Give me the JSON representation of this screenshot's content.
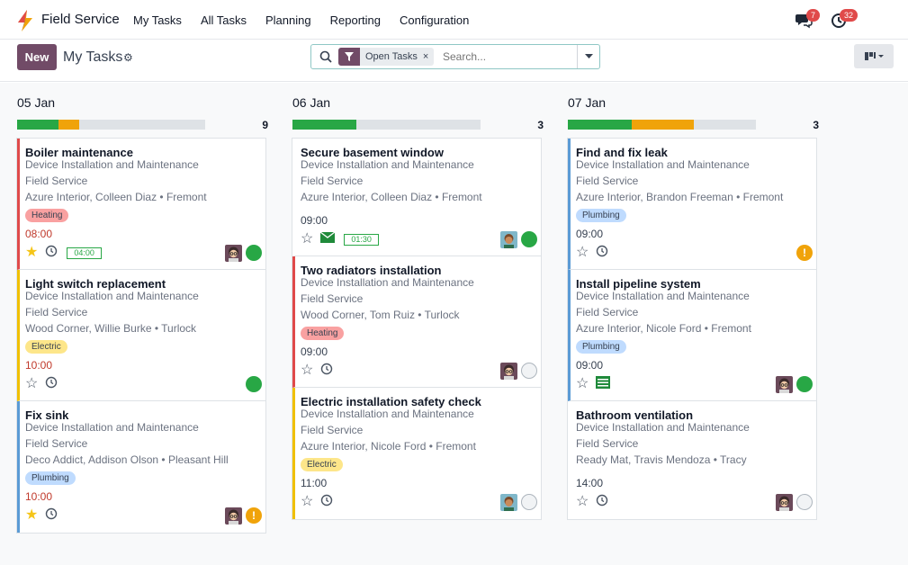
{
  "app": {
    "name": "Field Service"
  },
  "menu": [
    "My Tasks",
    "All Tasks",
    "Planning",
    "Reporting",
    "Configuration"
  ],
  "systray": {
    "messages_count": "7",
    "activities_count": "32"
  },
  "control": {
    "new_label": "New",
    "title": "My Tasks",
    "facet": "Open Tasks",
    "search_placeholder": "Search..."
  },
  "columns": [
    {
      "date": "05 Jan",
      "count": "9",
      "progress": {
        "done": 0.22,
        "warn": 0.11
      },
      "cards": [
        {
          "title": "Boiler maintenance",
          "project": "Device Installation and Maintenance",
          "team": "Field Service",
          "customer": "Azure Interior, Colleen Diaz • Fremont",
          "tag": "Heating",
          "time": "08:00",
          "overdue": true,
          "starred": true,
          "timer": "04:00",
          "status": "green",
          "avatar": "glasses"
        },
        {
          "title": "Light switch replacement",
          "project": "Device Installation and Maintenance",
          "team": "Field Service",
          "customer": "Wood Corner, Willie Burke • Turlock",
          "tag": "Electric",
          "time": "10:00",
          "overdue": true,
          "starred": false,
          "status": "green"
        },
        {
          "title": "Fix sink",
          "project": "Device Installation and Maintenance",
          "team": "Field Service",
          "customer": "Deco Addict, Addison Olson • Pleasant Hill",
          "tag": "Plumbing",
          "time": "10:00",
          "overdue": true,
          "starred": true,
          "status": "warning",
          "avatar": "glasses"
        }
      ]
    },
    {
      "date": "06 Jan",
      "count": "3",
      "progress": {
        "done": 0.34,
        "warn": 0
      },
      "cards": [
        {
          "title": "Secure basement window",
          "project": "Device Installation and Maintenance",
          "team": "Field Service",
          "customer": "Azure Interior, Colleen Diaz • Fremont",
          "time": "09:00",
          "overdue": false,
          "starred": false,
          "timer": "01:30",
          "status": "green",
          "avatar": "curly"
        },
        {
          "title": "Two radiators installation",
          "project": "Device Installation and Maintenance",
          "team": "Field Service",
          "customer": "Wood Corner, Tom Ruiz • Turlock",
          "tag": "Heating",
          "time": "09:00",
          "overdue": false,
          "starred": false,
          "status": "grey",
          "avatar": "glasses"
        },
        {
          "title": "Electric installation safety check",
          "project": "Device Installation and Maintenance",
          "team": "Field Service",
          "customer": "Azure Interior, Nicole Ford • Fremont",
          "tag": "Electric",
          "time": "11:00",
          "overdue": false,
          "starred": false,
          "status": "grey",
          "avatar": "curly"
        }
      ]
    },
    {
      "date": "07 Jan",
      "count": "3",
      "progress": {
        "done": 0.34,
        "warn": 0.33
      },
      "cards": [
        {
          "title": "Find and fix leak",
          "project": "Device Installation and Maintenance",
          "team": "Field Service",
          "customer": "Azure Interior, Brandon Freeman • Fremont",
          "tag": "Plumbing",
          "time": "09:00",
          "overdue": false,
          "starred": false,
          "status": "warning"
        },
        {
          "title": "Install pipeline system",
          "project": "Device Installation and Maintenance",
          "team": "Field Service",
          "customer": "Azure Interior, Nicole Ford • Fremont",
          "tag": "Plumbing",
          "time": "09:00",
          "overdue": false,
          "starred": false,
          "activity": "list",
          "status": "green",
          "avatar": "glasses"
        },
        {
          "title": "Bathroom ventilation",
          "project": "Device Installation and Maintenance",
          "team": "Field Service",
          "customer": "Ready Mat, Travis Mendoza • Tracy",
          "time": "14:00",
          "overdue": false,
          "starred": false,
          "status": "grey",
          "avatar": "glasses"
        }
      ]
    }
  ],
  "colors": {
    "brand": "#714b67",
    "heating": "#f9a1a1",
    "electric": "#fde68a",
    "plumbing": "#bfdbfe",
    "overdue": "#c0392b",
    "done": "#28a745",
    "warn": "#f0a30a"
  }
}
